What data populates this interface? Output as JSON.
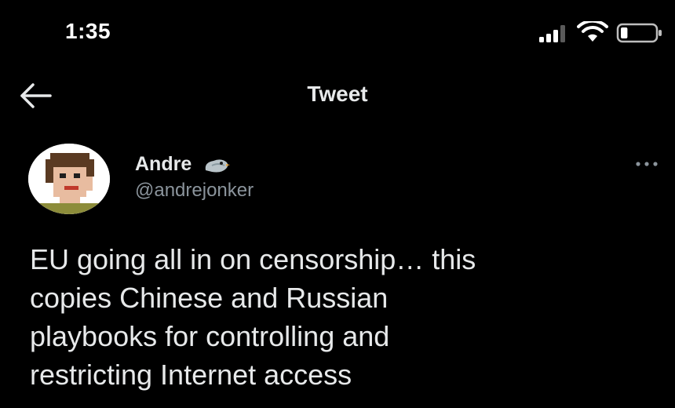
{
  "status_bar": {
    "time": "1:35",
    "icons": [
      "signal-icon",
      "wifi-icon",
      "battery-icon"
    ],
    "battery_level": 0.2
  },
  "header": {
    "back_icon": "arrow-left-icon",
    "title": "Tweet"
  },
  "tweet": {
    "author": {
      "name": "Andre",
      "handle": "@andrejonker",
      "name_emoji": "bird-icon"
    },
    "more_icon": "more-icon",
    "text": "EU going all in on censorship… this\ncopies Chinese and Russian\nplaybooks for controlling and\nrestricting Internet access"
  },
  "colors": {
    "background": "#000000",
    "text": "#e7e9ea",
    "muted": "#8b949c"
  }
}
